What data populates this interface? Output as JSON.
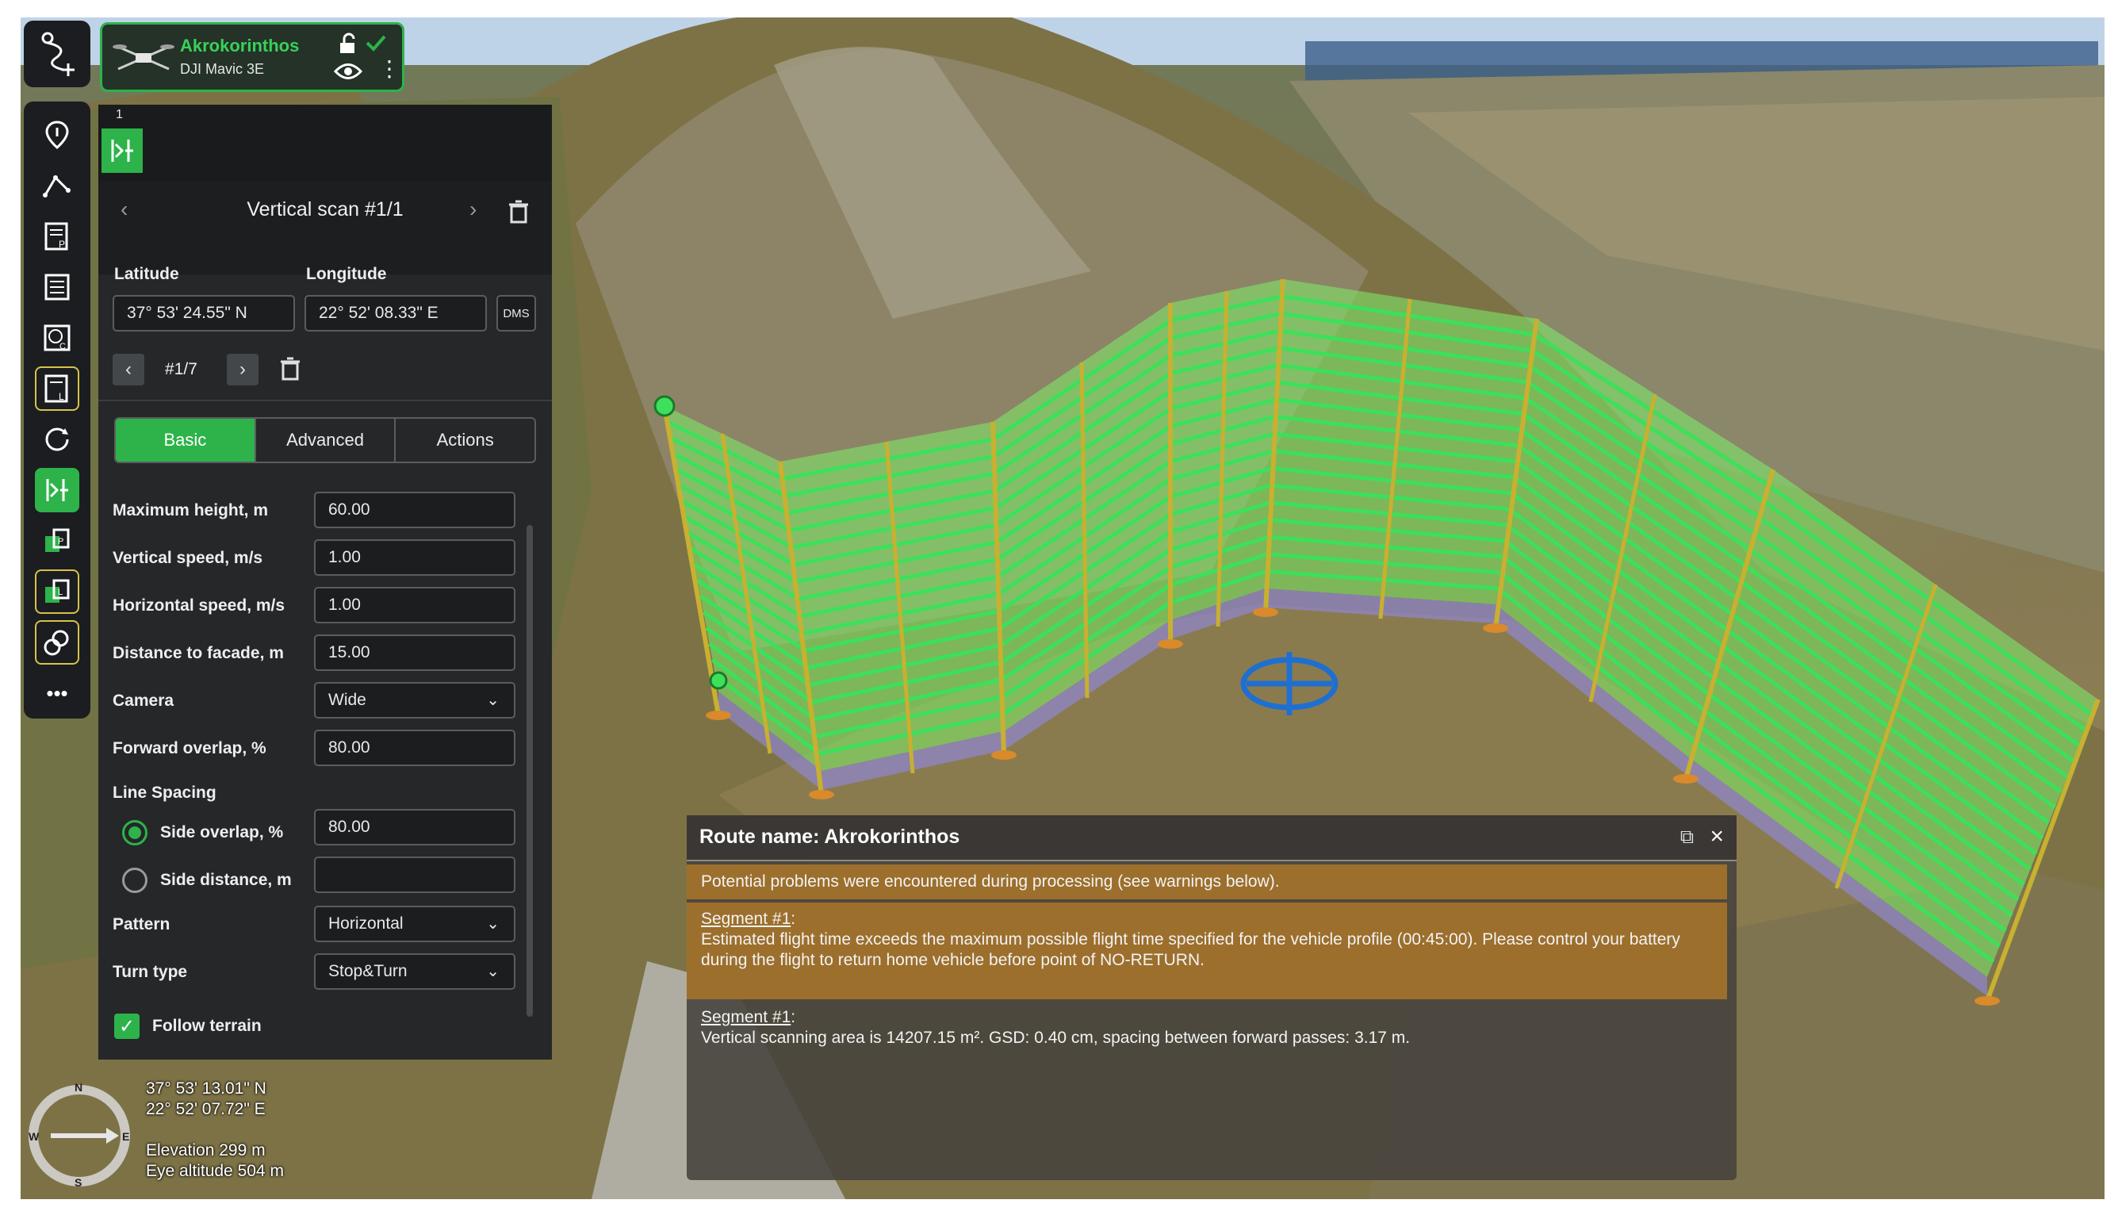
{
  "vehicle": {
    "name": "Akrokorinthos",
    "model": "DJI Mavic 3E"
  },
  "toolbar": {
    "items": [
      {
        "icon": "route-add-icon"
      },
      {
        "icon": "waypoint-pin-icon"
      },
      {
        "icon": "polyline-icon"
      },
      {
        "icon": "photoplan-icon"
      },
      {
        "icon": "list-icon"
      },
      {
        "icon": "circle-grid-icon"
      },
      {
        "icon": "linear-plan-icon"
      },
      {
        "icon": "circle-refresh-icon"
      },
      {
        "icon": "vertical-scan-icon"
      },
      {
        "icon": "facade-photoplan-icon"
      },
      {
        "icon": "facade-linear-icon"
      },
      {
        "icon": "search-area-icon"
      },
      {
        "icon": "more-icon"
      }
    ],
    "more_label": "•••"
  },
  "panel": {
    "waypoint_index": "1",
    "scan_title": "Vertical scan #1/1",
    "latitude_label": "Latitude",
    "longitude_label": "Longitude",
    "latitude_value": "37° 53' 24.55\" N",
    "longitude_value": "22° 52' 08.33\" E",
    "dms_label": "DMS",
    "point_counter": "#1/7",
    "tabs": [
      "Basic",
      "Advanced",
      "Actions"
    ],
    "fields": {
      "max_height_label": "Maximum height, m",
      "max_height_value": "60.00",
      "vertical_speed_label": "Vertical speed, m/s",
      "vertical_speed_value": "1.00",
      "horizontal_speed_label": "Horizontal speed, m/s",
      "horizontal_speed_value": "1.00",
      "distance_label": "Distance to facade, m",
      "distance_value": "15.00",
      "camera_label": "Camera",
      "camera_value": "Wide",
      "forward_overlap_label": "Forward overlap, %",
      "forward_overlap_value": "80.00",
      "line_spacing_label": "Line Spacing",
      "side_overlap_label": "Side overlap, %",
      "side_overlap_value": "80.00",
      "side_distance_label": "Side distance, m",
      "side_distance_value": "",
      "pattern_label": "Pattern",
      "pattern_value": "Horizontal",
      "turn_type_label": "Turn type",
      "turn_type_value": "Stop&Turn",
      "follow_terrain_label": "Follow terrain",
      "follow_terrain_checked": true
    }
  },
  "status": {
    "latitude": "37° 53' 13.01\" N",
    "longitude": "22° 52' 07.72\" E",
    "elevation": "Elevation 299 m",
    "eye_altitude": "Eye altitude 504 m"
  },
  "compass": {
    "n": "N",
    "s": "S",
    "e": "E",
    "w": "W"
  },
  "route_dialog": {
    "title": "Route name: Akrokorinthos",
    "warning_header": "Potential problems were encountered during processing (see warnings below).",
    "warnings": [
      {
        "segment": "Segment #1",
        "text": "Estimated flight time exceeds the maximum possible flight time specified for the vehicle profile (00:45:00). Please control your battery during the flight to return home vehicle before point of NO-RETURN."
      }
    ],
    "info": [
      {
        "segment": "Segment #1",
        "text": "Vertical scanning area is 14207.15 m². GSD: 0.40 cm, spacing between forward passes: 3.17 m."
      }
    ]
  },
  "colors": {
    "accent_green": "#2db34a",
    "panel_bg": "#252729",
    "warning_bg": "#9c6f2d",
    "scan_green": "#7ef06a",
    "frame_yellow": "#c8b030"
  }
}
